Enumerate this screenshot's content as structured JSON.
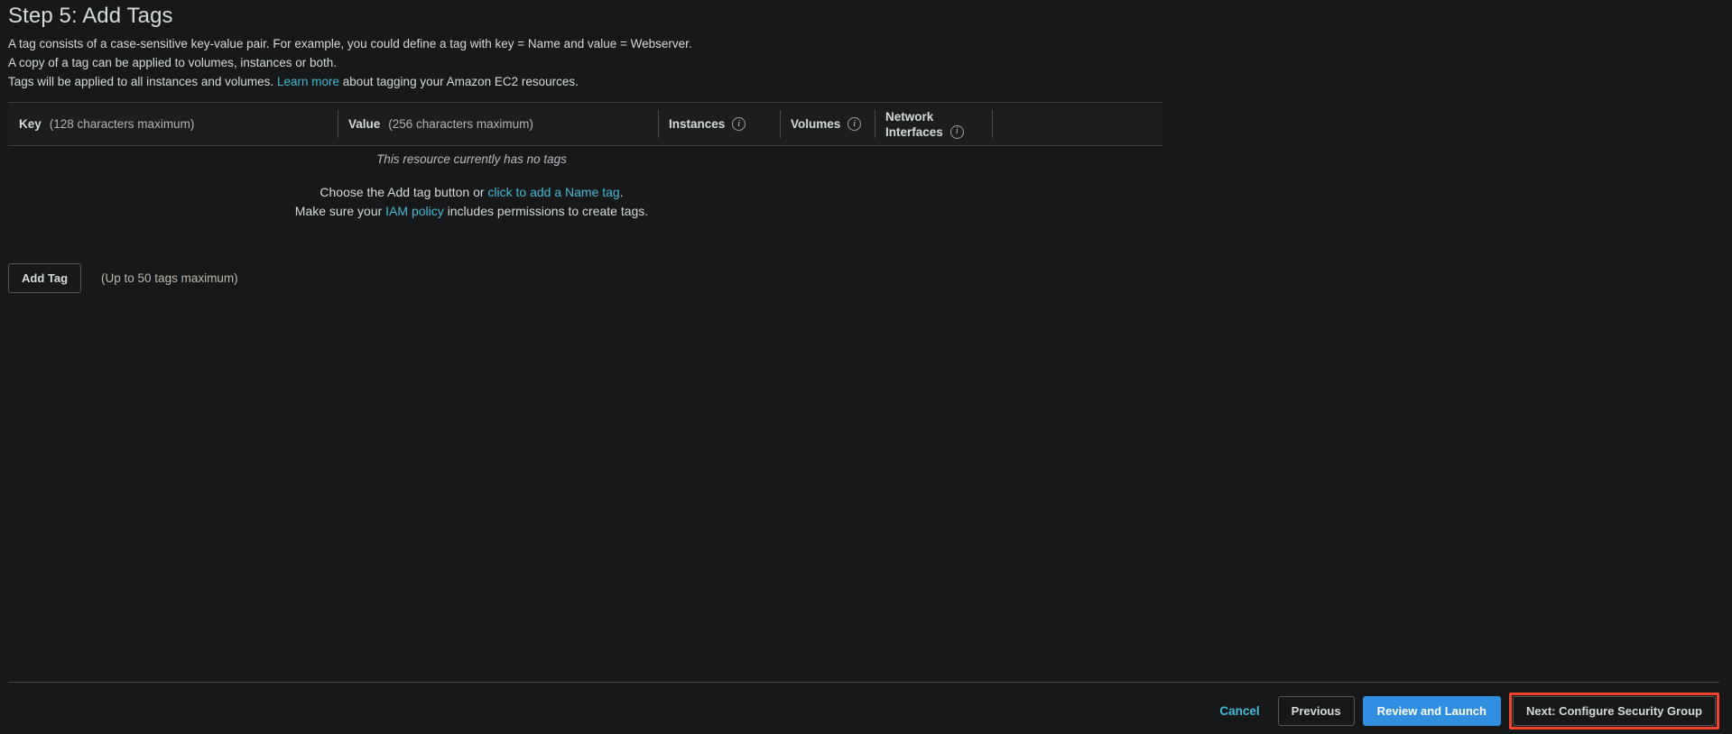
{
  "page": {
    "title": "Step 5: Add Tags",
    "intro": {
      "line1": "A tag consists of a case-sensitive key-value pair. For example, you could define a tag with key = Name and value = Webserver.",
      "line2": "A copy of a tag can be applied to volumes, instances or both.",
      "line3_prefix": "Tags will be applied to all instances and volumes.",
      "line3_link": "Learn more",
      "line3_suffix": "about tagging your Amazon EC2 resources."
    }
  },
  "table": {
    "columns": {
      "key_label": "Key",
      "key_hint": "(128 characters maximum)",
      "value_label": "Value",
      "value_hint": "(256 characters maximum)",
      "instances_label": "Instances",
      "volumes_label": "Volumes",
      "network_interfaces_label_line1": "Network",
      "network_interfaces_label_line2": "Interfaces"
    },
    "info_icon_glyph": "i",
    "empty_state": {
      "title": "This resource currently has no tags",
      "body_line1_prefix": "Choose the Add tag button or",
      "body_line1_link": "click to add a Name tag",
      "body_line1_suffix": ".",
      "body_line2_prefix": "Make sure your",
      "body_line2_link": "IAM policy",
      "body_line2_suffix": "includes permissions to create tags."
    }
  },
  "actions": {
    "add_tag_label": "Add Tag",
    "add_tag_hint": "(Up to 50 tags maximum)"
  },
  "footer": {
    "cancel_label": "Cancel",
    "previous_label": "Previous",
    "review_launch_label": "Review and Launch",
    "next_label": "Next: Configure Security Group"
  },
  "colors": {
    "background": "#16181a",
    "surface": "#1b1d1f",
    "text": "#d5dbdb",
    "link": "#44b9d6",
    "primary_button": "#2f8ee0",
    "highlight_outline": "#f4432f",
    "hint_text": "#c4b9ab",
    "border": "#3a3f44"
  }
}
